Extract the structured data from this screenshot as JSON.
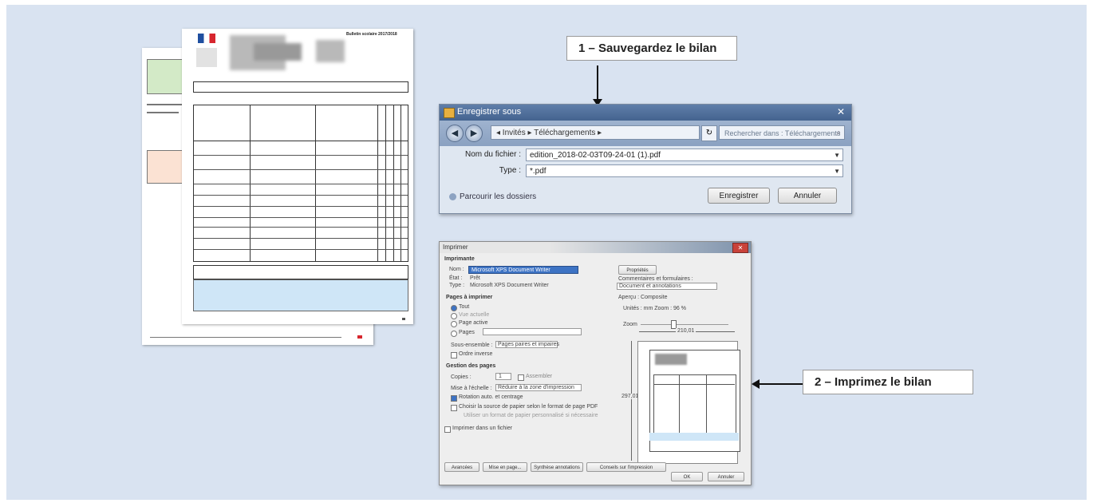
{
  "captions": {
    "step1": "1 – Sauvegardez le bilan",
    "step2": "2 – Imprimez le bilan"
  },
  "save_dialog": {
    "title": "Enregistrer sous",
    "address": "◂ Invités ▸ Téléchargements ▸",
    "search_placeholder": "Rechercher dans : Téléchargements",
    "filename_label": "Nom du fichier :",
    "filename_value": "edition_2018-02-03T09-24-01 (1).pdf",
    "type_label": "Type :",
    "type_value": "*.pdf",
    "browse_label": "Parcourir les dossiers",
    "save_button": "Enregistrer",
    "cancel_button": "Annuler"
  },
  "print_dialog": {
    "title": "Imprimer",
    "printer_section": "Imprimante",
    "name_label": "Nom :",
    "printer_name": "Microsoft XPS Document Writer",
    "status_label": "État :",
    "status_value": "Prêt",
    "type_label": "Type :",
    "type_value": "Microsoft XPS Document Writer",
    "properties_button": "Propriétés",
    "comments_label": "Commentaires et formulaires :",
    "comments_value": "Document et annotations",
    "range_section": "Pages à imprimer",
    "all_label": "Tout",
    "current_view_label": "Vue actuelle",
    "current_page_label": "Page active",
    "pages_label": "Pages",
    "subset_label": "Sous-ensemble :",
    "subset_value": "Pages paires et impaires",
    "reverse_label": "Ordre inverse",
    "handling_section": "Gestion des pages",
    "copies_label": "Copies :",
    "copies_value": "1",
    "collate_label": "Assembler",
    "scaling_label": "Mise à l'échelle :",
    "scaling_value": "Réduire à la zone d'impression",
    "autorotate_label": "Rotation auto. et centrage",
    "paper_source_label": "Choisir la source de papier selon le format de page PDF",
    "custom_paper_label": "Utiliser un format de papier personnalisé si nécessaire",
    "file_label": "Imprimer dans un fichier",
    "preview_section": "Aperçu : Composite",
    "zoom_label": "Zoom",
    "preview_width": "210,01",
    "preview_height": "297,01",
    "units_label": "Unités : mm   Zoom : 96 %",
    "advanced_button": "Avancées",
    "page_setup_button": "Mise en page...",
    "summarize_button": "Synthèse annotations",
    "printing_tips_button": "Conseils sur l'impression",
    "ok_button": "OK",
    "cancel_button": "Annuler"
  },
  "document": {
    "header_title": "Bulletin scolaire 2017/2018"
  }
}
